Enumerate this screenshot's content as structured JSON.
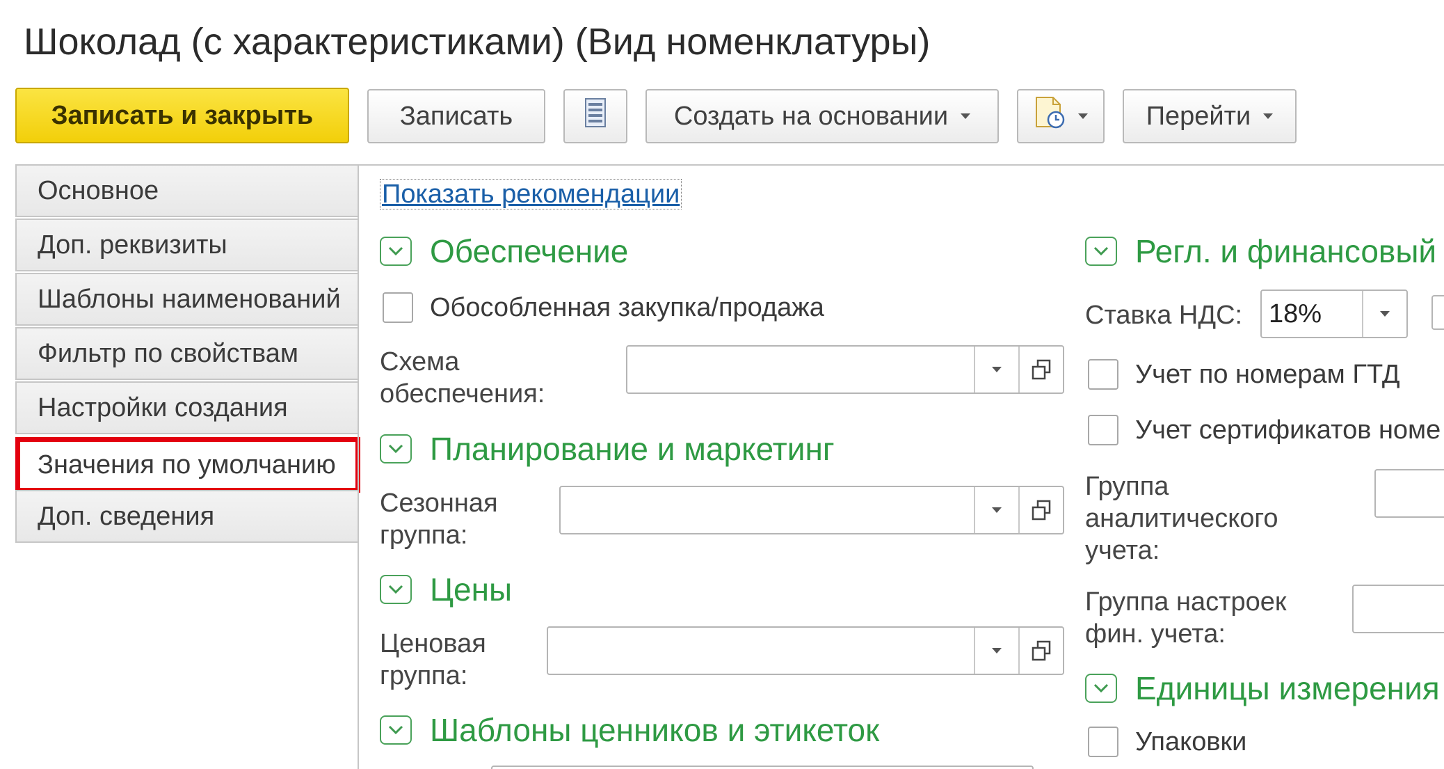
{
  "window": {
    "title": "Шоколад (с характеристиками) (Вид номенклатуры)"
  },
  "toolbar": {
    "save_close_label": "Записать и закрыть",
    "save_label": "Записать",
    "create_based_label": "Создать на основании",
    "goto_label": "Перейти"
  },
  "sidebar": {
    "items": [
      {
        "label": "Основное"
      },
      {
        "label": "Доп. реквизиты"
      },
      {
        "label": "Шаблоны наименований"
      },
      {
        "label": "Фильтр по свойствам"
      },
      {
        "label": "Настройки создания"
      },
      {
        "label": "Значения по умолчанию",
        "highlighted": true
      },
      {
        "label": "Доп. сведения"
      }
    ],
    "highlight_color": "#e3000f"
  },
  "content": {
    "recommendations_link": "Показать рекомендации",
    "left": {
      "supply": {
        "title": "Обеспечение",
        "separate_purchase": "Обособленная закупка/продажа",
        "scheme_label_1": "Схема",
        "scheme_label_2": "обеспечения:",
        "scheme_value": ""
      },
      "planning": {
        "title": "Планирование и маркетинг",
        "season_label_1": "Сезонная",
        "season_label_2": "группа:",
        "season_value": ""
      },
      "prices": {
        "title": "Цены",
        "price_label_1": "Ценовая",
        "price_label_2": "группа:",
        "price_value": ""
      },
      "templates": {
        "title": "Шаблоны ценников и этикеток"
      }
    },
    "right": {
      "regl": {
        "title": "Регл. и финансовый",
        "vat_label": "Ставка НДС:",
        "vat_value": "18%",
        "gtd_label": "Учет по номерам ГТД",
        "cert_label": "Учет сертификатов номе",
        "analytic_label_1": "Группа",
        "analytic_label_2": "аналитического",
        "analytic_label_3": "учета:",
        "fin_label_1": "Группа настроек",
        "fin_label_2": "фин. учета:"
      },
      "units": {
        "title": "Единицы измерения",
        "packages_label": "Упаковки"
      }
    }
  },
  "colors": {
    "primary_button": "#f2cf0a",
    "section_title": "#2e9a43",
    "link": "#1a5fa8"
  }
}
